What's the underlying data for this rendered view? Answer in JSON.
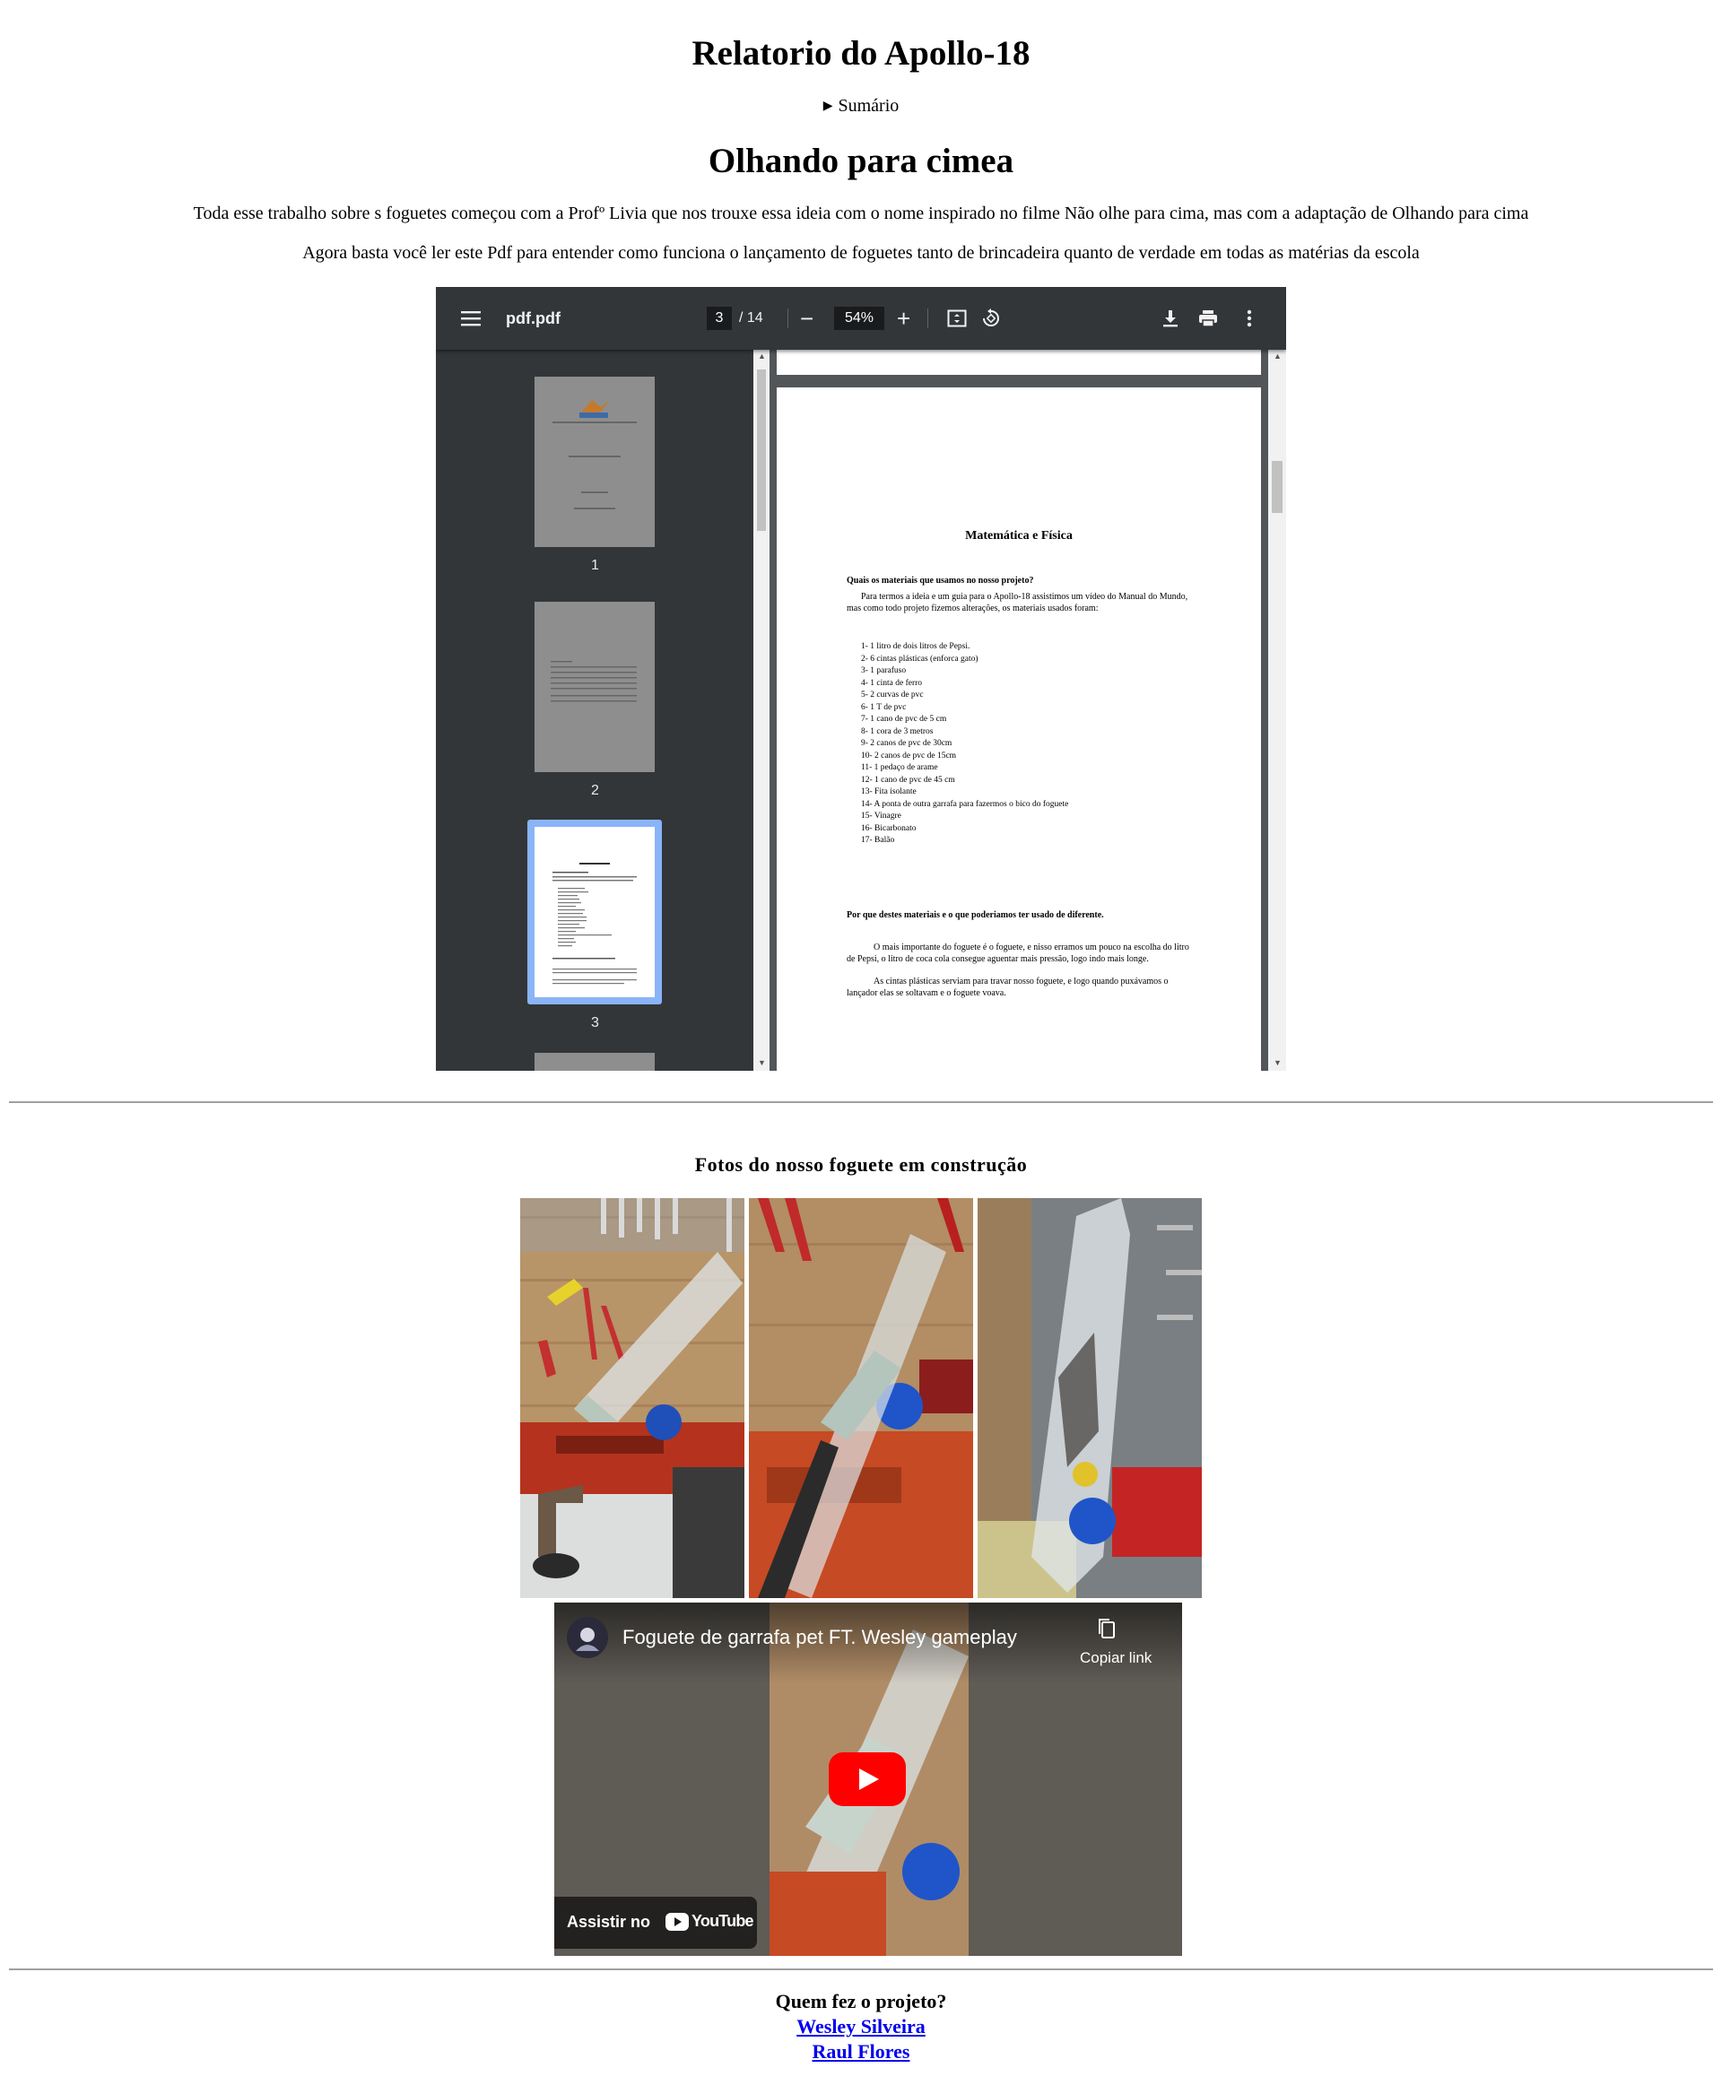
{
  "page": {
    "title": "Relatorio do Apollo-18",
    "summary_label": "Sumário",
    "heading": "Olhando para cimea",
    "intro_1": "Toda esse trabalho sobre s foguetes começou com a Profº Livia que nos trouxe essa ideia com o nome inspirado no filme Não olhe para cima, mas com a adaptação de Olhando para cima",
    "intro_2": "Agora basta você ler este Pdf para entender como funciona o lançamento de foguetes tanto de brincadeira quanto de verdade em todas as matérias da escola"
  },
  "pdf_viewer": {
    "file_name": "pdf.pdf",
    "current_page": "3",
    "total_pages": "/ 14",
    "zoom": "54%",
    "icons": [
      "menu-icon",
      "zoom-out-icon",
      "zoom-in-icon",
      "fit-page-icon",
      "rotate-icon",
      "download-icon",
      "print-icon",
      "more-options-icon"
    ],
    "thumbnails": [
      {
        "label": "1"
      },
      {
        "label": "2"
      },
      {
        "label": "3"
      }
    ],
    "document": {
      "title": "Matemática e Física",
      "question_1": "Quais os materiais que usamos no nosso projeto?",
      "paragraph_1": "Para termos a ideia e um guia para o Apollo-18 assistimos um vídeo do Manual do Mundo, mas como todo projeto fizemos alterações, os materiais usados foram:",
      "materials": [
        "1-   1 litro de dois litros de Pepsi.",
        "2-  6 cintas plásticas (enforca gato)",
        "3-  1 parafuso",
        "4-  1 cinta de ferro",
        "5-  2 curvas de pvc",
        "6-  1 T de pvc",
        "7-  1 cano de pvc de 5 cm",
        "8-  1 cora de 3 metros",
        "9-  2 canos de pvc de 30cm",
        "10- 2 canos de pvc de 15cm",
        "11- 1 pedaço de arame",
        "12-  1 cano de pvc de 45 cm",
        "13- Fita isolante",
        "14- A ponta de outra garrafa para fazermos o bico do foguete",
        "15- Vinagre",
        "16- Bicarbonato",
        "17- Balão"
      ],
      "question_2": "Por que destes materiais e o que poderiamos ter usado de diferente.",
      "paragraph_2": "O mais importante do foguete é o foguete, e nisso erramos um pouco na escolha do litro de Pepsi, o litro de coca cola consegue aguentar mais pressão, logo indo mais longe.",
      "paragraph_3": "As cintas plásticas serviam para travar nosso foguete, e logo quando puxávamos o lançador elas se soltavam e o foguete voava."
    }
  },
  "photos": {
    "title": "Fotos do nosso foguete em construção"
  },
  "video": {
    "title": "Foguete de garrafa pet FT. Wesley gameplay",
    "copy_link": "Copiar link",
    "watch_on": "Assistir no",
    "youtube": "YouTube"
  },
  "credits": {
    "title": "Quem fez o projeto?",
    "authors": [
      "Wesley Silveira",
      "Raul Flores"
    ]
  },
  "colors": {
    "pdf_toolbar": "#323639",
    "pdf_background": "#525659",
    "link": "#0000ee",
    "youtube_red": "#ff0000"
  }
}
